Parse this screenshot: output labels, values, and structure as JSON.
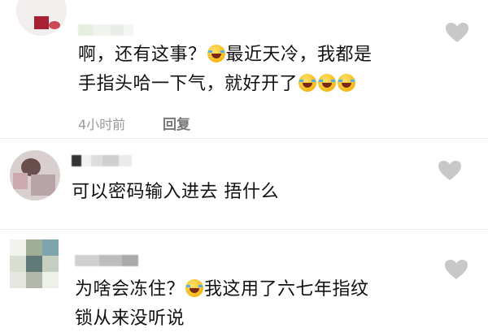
{
  "comments": [
    {
      "text_parts": [
        "啊，还有这事？",
        "emoji",
        "最近天冷，我都是"
      ],
      "line2_parts": [
        "手指头哈一下气，就好开了",
        "emoji",
        "emoji",
        "emoji"
      ],
      "time": "4小时前",
      "reply_label": "回复"
    },
    {
      "text": "可以密码输入进去 捂什么"
    },
    {
      "line1_parts": [
        "为啥会冻住？",
        "emoji",
        "我这用了六七年指纹"
      ],
      "line2": "锁从来没听说"
    }
  ],
  "icons": {
    "like": "heart-icon",
    "emoji": "rofl-emoji-icon"
  },
  "colors": {
    "heart": "#c8c8c8",
    "meta": "#9a9a9a",
    "text": "#111111"
  }
}
